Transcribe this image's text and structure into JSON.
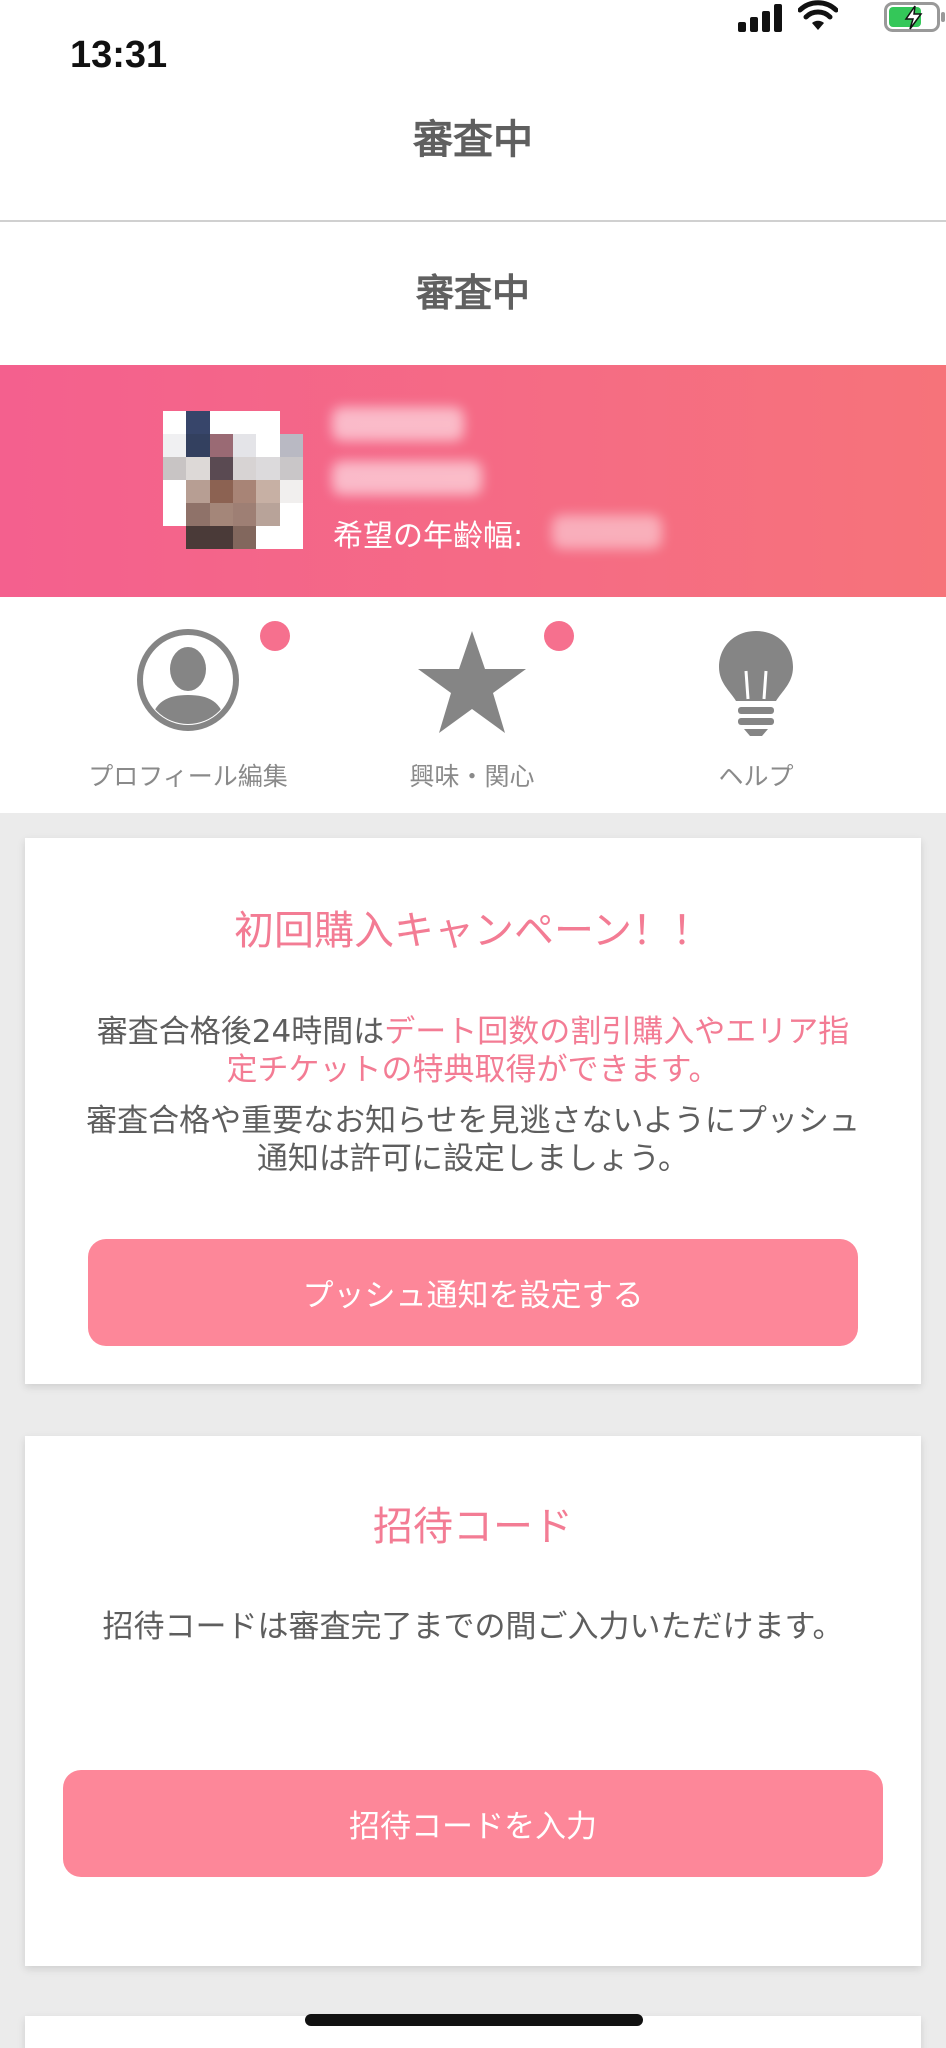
{
  "status_bar": {
    "time": "13:31"
  },
  "nav": {
    "title": "審査中"
  },
  "sub_header": {
    "title": "審査中"
  },
  "profile": {
    "age_range_label": "希望の年齢幅:"
  },
  "quick_menu": [
    {
      "label": "プロフィール編集",
      "icon": "person-circle-icon",
      "badge": true
    },
    {
      "label": "興味・関心",
      "icon": "star-icon",
      "badge": true
    },
    {
      "label": "ヘルプ",
      "icon": "lightbulb-icon",
      "badge": false
    }
  ],
  "campaign_card": {
    "title": "初回購入キャンペーン！！",
    "body_prefix": "審査合格後24時間は",
    "body_highlight": "デート回数の割引購入やエリア指定チケットの特典取得ができます。",
    "body_second": "審査合格や重要なお知らせを見逃さないようにプッシュ通知は許可に設定しましょう。",
    "button_label": "プッシュ通知を設定する"
  },
  "invite_card": {
    "title": "招待コード",
    "body": "招待コードは審査完了までの間ご入力いただけます。",
    "button_label": "招待コードを入力"
  },
  "colors": {
    "accent": "#f37c94",
    "button": "#fd8799",
    "banner_start": "#f4608e",
    "banner_end": "#f6737a",
    "badge": "#f6708e"
  }
}
